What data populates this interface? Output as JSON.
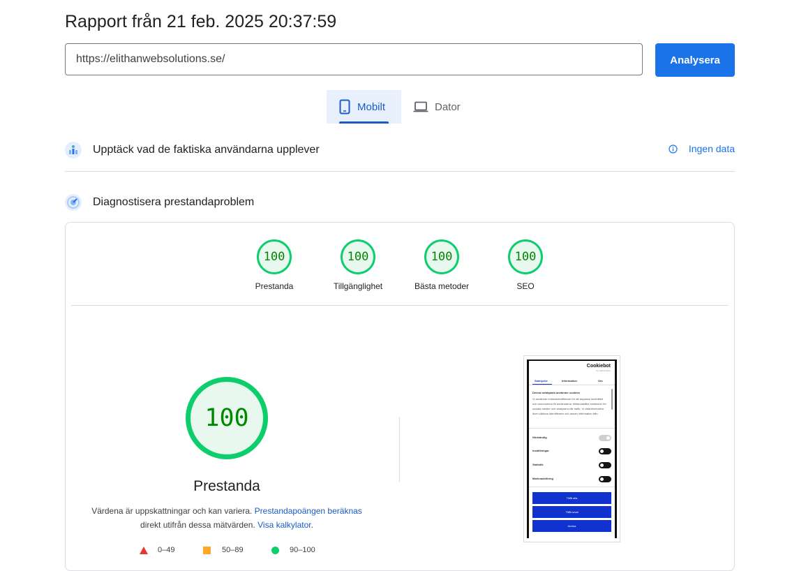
{
  "report": {
    "title": "Rapport från 21 feb. 2025 20:37:59"
  },
  "search": {
    "url": "https://elithanwebsolutions.se/",
    "analyze_label": "Analysera"
  },
  "tabs": [
    {
      "label": "Mobilt",
      "icon": "phone-icon",
      "active": true
    },
    {
      "label": "Dator",
      "icon": "laptop-icon",
      "active": false
    }
  ],
  "field_section": {
    "label": "Upptäck vad de faktiska användarna upplever",
    "status": "Ingen data",
    "icon": "users-icon",
    "status_icon": "info-icon"
  },
  "lab_section": {
    "label": "Diagnostisera prestandaproblem",
    "icon": "diagnose-icon"
  },
  "scores": [
    {
      "value": "100",
      "label": "Prestanda"
    },
    {
      "value": "100",
      "label": "Tillgänglighet"
    },
    {
      "value": "100",
      "label": "Bästa metoder"
    },
    {
      "value": "100",
      "label": "SEO"
    }
  ],
  "main_score": {
    "value": "100",
    "label": "Prestanda",
    "desc_part1": "Värdena är uppskattningar och kan variera.",
    "link1": "Prestandapoängen beräknas",
    "desc_part2": "direkt utifrån dessa mätvärden.",
    "link2": "Visa kalkylator",
    "desc_end": "."
  },
  "legend": [
    {
      "range": "0–49",
      "shape": "triangle",
      "color": "#e53935"
    },
    {
      "range": "50–89",
      "shape": "square",
      "color": "#ffa726"
    },
    {
      "range": "90–100",
      "shape": "circle",
      "color": "#0cce6b"
    }
  ],
  "screenshot": {
    "brand": "Cookiebot",
    "brand_sub": "by Usercentrics",
    "tabs": [
      "Samtycke",
      "Information",
      "Om"
    ],
    "heading": "Denna webbplats använder cookies",
    "body": "Vi använder enhetsidentifierare för att anpassa innehållet och annonserna till användarna, tillhandahålla funktioner för sociala medier och analysera vår trafik. Vi vidarebefordrar även sådana identifierare och annan information från",
    "toggles": [
      {
        "label": "Nödvändig",
        "on": false
      },
      {
        "label": "Inställningar",
        "on": true
      },
      {
        "label": "Statistik",
        "on": true
      },
      {
        "label": "Marknadsföring",
        "on": true
      }
    ],
    "buttons": [
      "Tillåt alla",
      "Tillåt urval",
      "Avvisa"
    ]
  },
  "colors": {
    "accent": "#1a73e8",
    "pass": "#0cce6b",
    "pass_text": "#008800"
  }
}
